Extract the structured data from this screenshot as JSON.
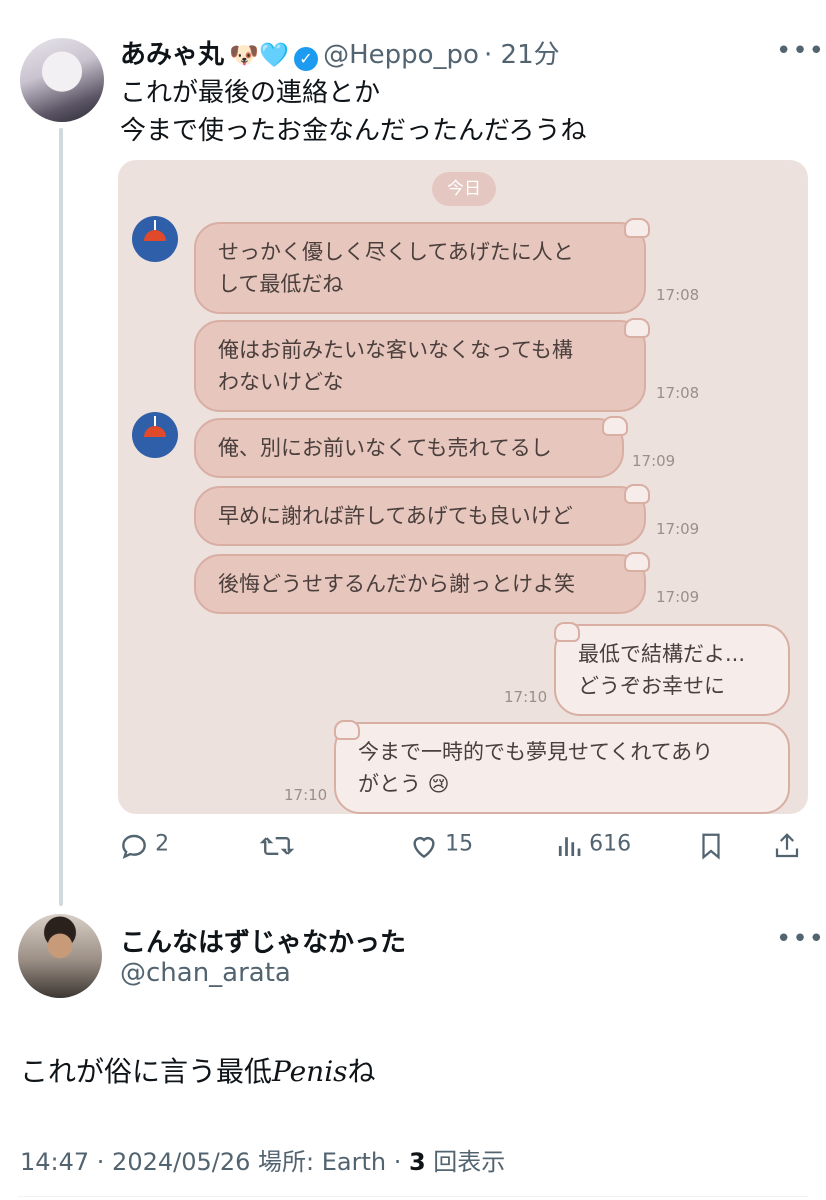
{
  "tweet": {
    "display_name": "あみゃ丸",
    "name_emojis": "🐶🩵",
    "handle": "@Heppo_po",
    "time": "· 21分",
    "more": "•••",
    "text_line1": "これが最後の連絡とか",
    "text_line2": "今まで使ったお金なんだったんだろうね",
    "actions": {
      "reply_count": "2",
      "retweet_count": "",
      "like_count": "15",
      "view_count": "616"
    }
  },
  "chat": {
    "day_label": "今日",
    "messages": [
      {
        "side": "in",
        "line1": "せっかく優しく尽くしてあげたに人と",
        "line2": "して最低だね",
        "time": "17:08"
      },
      {
        "side": "in",
        "line1": "俺はお前みたいな客いなくなっても構",
        "line2": "わないけどな",
        "time": "17:08"
      },
      {
        "side": "in",
        "line1": "俺、別にお前いなくても売れてるし",
        "time": "17:09"
      },
      {
        "side": "in",
        "line1": "早めに謝れば許してあげても良いけど",
        "time": "17:09"
      },
      {
        "side": "in",
        "line1": "後悔どうせするんだから謝っとけよ笑",
        "time": "17:09"
      },
      {
        "side": "out",
        "line1": "最低で結構だよ...",
        "line2": "どうぞお幸せに",
        "time": "17:10"
      },
      {
        "side": "out",
        "line1": "今まで一時的でも夢見せてくれてあり",
        "line2": "がとう 😢",
        "time": "17:10"
      }
    ]
  },
  "reply": {
    "display_name": "こんなはずじゃなかった",
    "handle": "@chan_arata",
    "more": "•••",
    "text_prefix": "これが俗に言う最低",
    "text_italic": "Penis",
    "text_suffix": "ね",
    "meta_time": "14:47 · 2024/05/26 場所: Earth · ",
    "meta_views": "3",
    "meta_views_label": " 回表示"
  },
  "colors": {
    "accent": "#1d9bf0",
    "chat_bg": "#ede1de",
    "bubble_in": "#e6c6bd",
    "bubble_out": "#f6ecea",
    "muted": "#536471"
  },
  "icons": [
    "reply-icon",
    "retweet-icon",
    "like-icon",
    "views-icon",
    "bookmark-icon",
    "share-icon",
    "verified-icon",
    "more-icon"
  ]
}
